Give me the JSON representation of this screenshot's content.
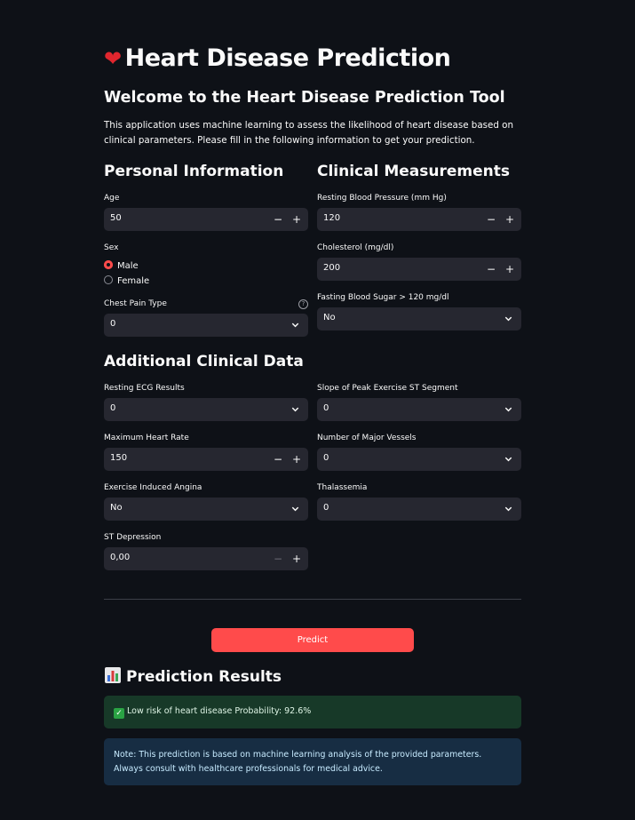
{
  "header": {
    "title": "Heart Disease Prediction",
    "welcome": "Welcome to the Heart Disease Prediction Tool",
    "intro": "This application uses machine learning to assess the likelihood of heart disease based on clinical parameters. Please fill in the following information to get your prediction."
  },
  "personal": {
    "title": "Personal Information",
    "age_label": "Age",
    "age_value": "50",
    "sex_label": "Sex",
    "sex_options": [
      "Male",
      "Female"
    ],
    "sex_selected": "Male",
    "chest_pain_label": "Chest Pain Type",
    "chest_pain_value": "0"
  },
  "clinical": {
    "title": "Clinical Measurements",
    "bp_label": "Resting Blood Pressure (mm Hg)",
    "bp_value": "120",
    "chol_label": "Cholesterol (mg/dl)",
    "chol_value": "200",
    "fbs_label": "Fasting Blood Sugar > 120 mg/dl",
    "fbs_value": "No"
  },
  "additional": {
    "title": "Additional Clinical Data",
    "ecg_label": "Resting ECG Results",
    "ecg_value": "0",
    "slope_label": "Slope of Peak Exercise ST Segment",
    "slope_value": "0",
    "max_hr_label": "Maximum Heart Rate",
    "max_hr_value": "150",
    "vessels_label": "Number of Major Vessels",
    "vessels_value": "0",
    "angina_label": "Exercise Induced Angina",
    "angina_value": "No",
    "thal_label": "Thalassemia",
    "thal_value": "0",
    "st_label": "ST Depression",
    "st_value": "0,00"
  },
  "controls": {
    "minus": "−",
    "plus": "+",
    "help": "?",
    "predict_label": "Predict"
  },
  "results": {
    "title": "Prediction Results",
    "success_text": "Low risk of heart disease Probability: 92.6%",
    "note": "Note: This prediction is based on machine learning analysis of the provided parameters. Always consult with healthcare professionals for medical advice."
  },
  "colors": {
    "background": "#0e1117",
    "accent": "#ff4b4b",
    "input_bg": "#262730",
    "success_bg": "#173928",
    "info_bg": "#172d43"
  }
}
